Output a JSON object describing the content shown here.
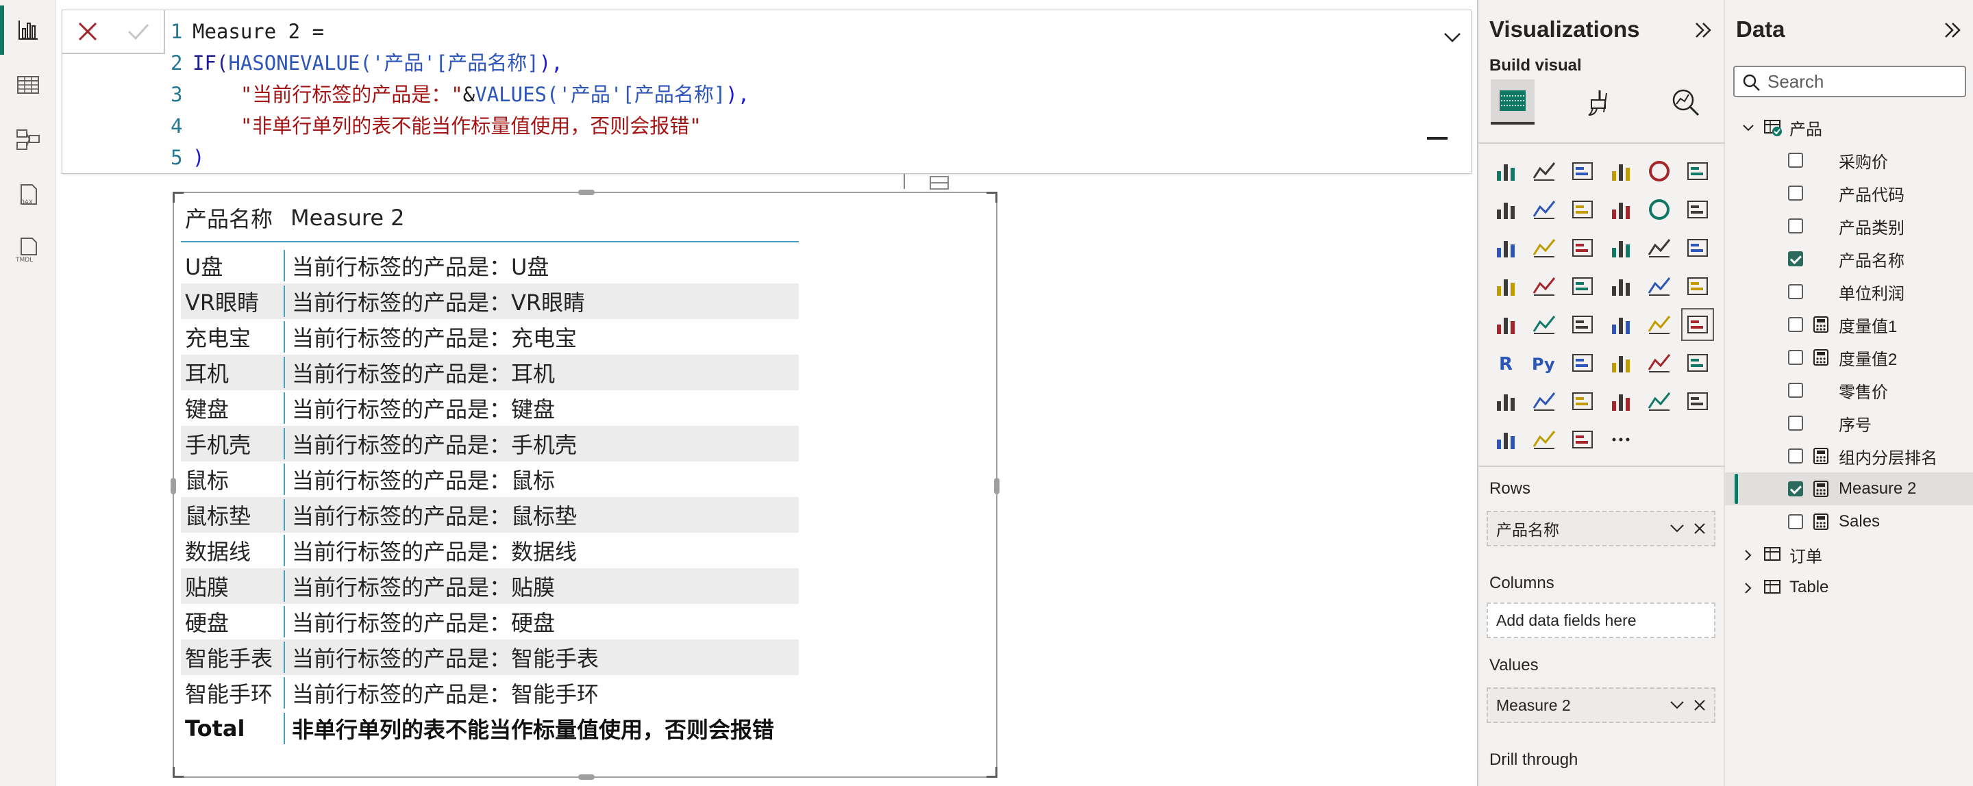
{
  "leftnav": {
    "items": [
      {
        "name": "report-view",
        "icon": "bar-chart-icon"
      },
      {
        "name": "table-view",
        "icon": "table-grid-icon"
      },
      {
        "name": "model-view",
        "icon": "model-diagram-icon"
      },
      {
        "name": "dax-query-view",
        "icon": "dax-icon",
        "label": "DAX"
      },
      {
        "name": "tmdl-view",
        "icon": "tmdl-icon",
        "label": "TMDL"
      }
    ]
  },
  "formula_bar": {
    "lines": [
      {
        "num": "1",
        "tokens": [
          {
            "t": "Measure 2 =",
            "k": "txt"
          }
        ]
      },
      {
        "num": "2",
        "tokens": [
          {
            "t": "IF(",
            "k": "kw"
          },
          {
            "t": "HASONEVALUE(",
            "k": "fn"
          },
          {
            "t": "'产品'[产品名称]",
            "k": "fn"
          },
          {
            "t": "),",
            "k": "par"
          }
        ]
      },
      {
        "num": "3",
        "tokens": [
          {
            "t": "    ",
            "k": "txt"
          },
          {
            "t": "\"当前行标签的产品是：\"",
            "k": "str"
          },
          {
            "t": "&",
            "k": "txt"
          },
          {
            "t": "VALUES(",
            "k": "fn"
          },
          {
            "t": "'产品'[产品名称]",
            "k": "fn"
          },
          {
            "t": "),",
            "k": "par"
          }
        ]
      },
      {
        "num": "4",
        "tokens": [
          {
            "t": "    ",
            "k": "txt"
          },
          {
            "t": "\"非单行单列的表不能当作标量值使用，否则会报错\"",
            "k": "str"
          }
        ]
      },
      {
        "num": "5",
        "tokens": [
          {
            "t": ")",
            "k": "par"
          }
        ]
      }
    ]
  },
  "table_visual": {
    "headers": [
      "产品名称",
      "Measure 2"
    ],
    "rows": [
      [
        "U盘",
        "当前行标签的产品是：U盘"
      ],
      [
        "VR眼睛",
        "当前行标签的产品是：VR眼睛"
      ],
      [
        "充电宝",
        "当前行标签的产品是：充电宝"
      ],
      [
        "耳机",
        "当前行标签的产品是：耳机"
      ],
      [
        "键盘",
        "当前行标签的产品是：键盘"
      ],
      [
        "手机壳",
        "当前行标签的产品是：手机壳"
      ],
      [
        "鼠标",
        "当前行标签的产品是：鼠标"
      ],
      [
        "鼠标垫",
        "当前行标签的产品是：鼠标垫"
      ],
      [
        "数据线",
        "当前行标签的产品是：数据线"
      ],
      [
        "贴膜",
        "当前行标签的产品是：贴膜"
      ],
      [
        "硬盘",
        "当前行标签的产品是：硬盘"
      ],
      [
        "智能手表",
        "当前行标签的产品是：智能手表"
      ],
      [
        "智能手环",
        "当前行标签的产品是：智能手环"
      ]
    ],
    "total": [
      "Total",
      "非单行单列的表不能当作标量值使用，否则会报错"
    ]
  },
  "visualizations": {
    "title": "Visualizations",
    "build_visual_label": "Build visual",
    "rows_label": "Rows",
    "rows_field": "产品名称",
    "columns_label": "Columns",
    "columns_placeholder": "Add data fields here",
    "values_label": "Values",
    "values_field": "Measure 2",
    "drill_through_label": "Drill through"
  },
  "data_pane": {
    "title": "Data",
    "search_placeholder": "Search",
    "tables": [
      {
        "name": "产品",
        "expanded": true
      },
      {
        "name": "订单",
        "expanded": false
      },
      {
        "name": "Table",
        "expanded": false
      }
    ],
    "fields": [
      {
        "name": "采购价",
        "checked": false,
        "calc": false
      },
      {
        "name": "产品代码",
        "checked": false,
        "calc": false
      },
      {
        "name": "产品类别",
        "checked": false,
        "calc": false
      },
      {
        "name": "产品名称",
        "checked": true,
        "calc": false
      },
      {
        "name": "单位利润",
        "checked": false,
        "calc": false
      },
      {
        "name": "度量值1",
        "checked": false,
        "calc": true
      },
      {
        "name": "度量值2",
        "checked": false,
        "calc": true
      },
      {
        "name": "零售价",
        "checked": false,
        "calc": false
      },
      {
        "name": "序号",
        "checked": false,
        "calc": false
      },
      {
        "name": "组内分层排名",
        "checked": false,
        "calc": true
      },
      {
        "name": "Measure 2",
        "checked": true,
        "calc": true,
        "active": true
      },
      {
        "name": "Sales",
        "checked": false,
        "calc": true
      }
    ]
  },
  "colors": {
    "accent": "#117865",
    "header_rule": "#4a9ec2",
    "dax_string": "#a31515",
    "dax_function": "#2e55b8"
  }
}
